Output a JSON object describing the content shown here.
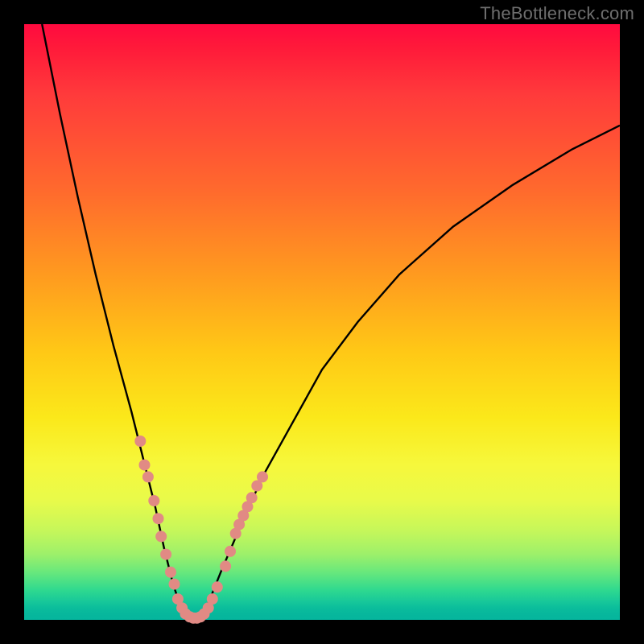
{
  "watermark": "TheBottleneck.com",
  "chart_data": {
    "type": "line",
    "title": "",
    "xlabel": "",
    "ylabel": "",
    "xlim": [
      0,
      100
    ],
    "ylim": [
      0,
      100
    ],
    "grid": false,
    "series": [
      {
        "name": "curve",
        "x": [
          3,
          6,
          9,
          12,
          15,
          18,
          20,
          22,
          23.5,
          25,
          26,
          27,
          28,
          29,
          30,
          31,
          33,
          36,
          40,
          45,
          50,
          56,
          63,
          72,
          82,
          92,
          100
        ],
        "y": [
          100,
          85,
          71,
          58,
          46,
          35,
          27,
          19,
          12,
          6,
          3,
          1,
          0,
          0,
          1,
          3,
          8,
          15,
          24,
          33,
          42,
          50,
          58,
          66,
          73,
          79,
          83
        ]
      }
    ],
    "markers": [
      {
        "x": 19.5,
        "y": 30
      },
      {
        "x": 20.2,
        "y": 26
      },
      {
        "x": 20.8,
        "y": 24
      },
      {
        "x": 21.8,
        "y": 20
      },
      {
        "x": 22.5,
        "y": 17
      },
      {
        "x": 23.0,
        "y": 14
      },
      {
        "x": 23.8,
        "y": 11
      },
      {
        "x": 24.6,
        "y": 8
      },
      {
        "x": 25.2,
        "y": 6
      },
      {
        "x": 25.8,
        "y": 3.5
      },
      {
        "x": 26.5,
        "y": 2
      },
      {
        "x": 27.1,
        "y": 1
      },
      {
        "x": 27.8,
        "y": 0.5
      },
      {
        "x": 28.4,
        "y": 0.3
      },
      {
        "x": 29.0,
        "y": 0.3
      },
      {
        "x": 29.6,
        "y": 0.5
      },
      {
        "x": 30.2,
        "y": 1
      },
      {
        "x": 30.9,
        "y": 2
      },
      {
        "x": 31.6,
        "y": 3.5
      },
      {
        "x": 32.4,
        "y": 5.5
      },
      {
        "x": 33.8,
        "y": 9
      },
      {
        "x": 34.6,
        "y": 11.5
      },
      {
        "x": 35.5,
        "y": 14.5
      },
      {
        "x": 36.1,
        "y": 16
      },
      {
        "x": 36.8,
        "y": 17.5
      },
      {
        "x": 37.5,
        "y": 19
      },
      {
        "x": 38.2,
        "y": 20.5
      },
      {
        "x": 39.1,
        "y": 22.5
      },
      {
        "x": 40.0,
        "y": 24
      }
    ],
    "marker_color": "#e18a84",
    "curve_color": "#000000"
  }
}
